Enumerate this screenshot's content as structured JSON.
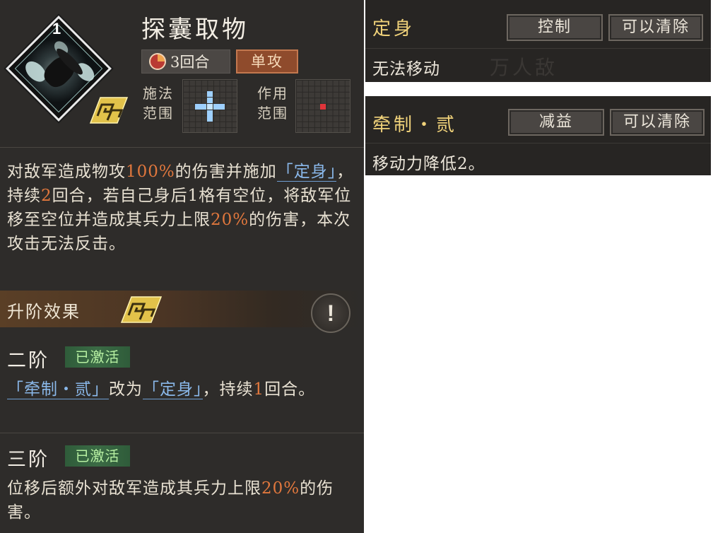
{
  "skill": {
    "level": "1",
    "name": "探囊取物",
    "turns_label": "3回合",
    "attack_type": "单攻",
    "cast_range_label": [
      "施法",
      "范围"
    ],
    "effect_range_label": [
      "作用",
      "范围"
    ]
  },
  "description": {
    "p1": "对敌军造成物攻",
    "v1": "100%",
    "p2": "的伤害并施加",
    "kw1": "「定身」",
    "p3": "，持续",
    "v2": "2",
    "p4": "回合，若自己身后1格有空位，将敌军位移至空位并造成其兵力上限",
    "v3": "20%",
    "p5": "的伤害，本次攻击无法反击。"
  },
  "upgrade": {
    "title": "升阶效果",
    "tier2": {
      "name": "二阶",
      "badge": "已激活",
      "kw1": "「牵制・贰」",
      "t1": "改为",
      "kw2": "「定身」",
      "t2": "，持续",
      "v1": "1",
      "t3": "回合。"
    },
    "tier3": {
      "name": "三阶",
      "badge": "已激活",
      "t1": "位移后额外对敌军造成其兵力上限",
      "v1": "20%",
      "t2": "的伤害。"
    }
  },
  "status_cards": [
    {
      "title": "定身",
      "category": "控制",
      "clearable": "可以清除",
      "text": "无法移动",
      "ghost": "万人敌"
    },
    {
      "title": "牵制・贰",
      "category": "减益",
      "clearable": "可以清除",
      "text": "移动力降低2。"
    }
  ],
  "colors": {
    "highlight": "#e0773d",
    "keyword": "#8ab8ea",
    "card_title": "#f0d27a",
    "active_badge": "#b7f0a2"
  }
}
